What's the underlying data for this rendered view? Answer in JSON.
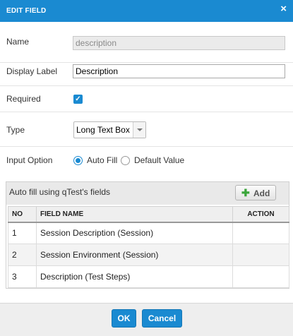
{
  "dialog": {
    "title": "EDIT FIELD",
    "close_glyph": "×"
  },
  "form": {
    "name": {
      "label": "Name",
      "value": "description",
      "disabled": true
    },
    "display_label": {
      "label": "Display Label",
      "value": "Description"
    },
    "required": {
      "label": "Required",
      "checked": true
    },
    "type": {
      "label": "Type",
      "selected": "Long Text Box"
    },
    "input_option": {
      "label": "Input Option",
      "options": [
        {
          "label": "Auto Fill",
          "selected": true
        },
        {
          "label": "Default Value",
          "selected": false
        }
      ]
    }
  },
  "autofill": {
    "title": "Auto fill using qTest's fields",
    "add_label": "Add",
    "columns": [
      "NO",
      "FIELD NAME",
      "ACTION"
    ],
    "rows": [
      {
        "no": "1",
        "field_name": "Session Description (Session)",
        "action": ""
      },
      {
        "no": "2",
        "field_name": "Session Environment (Session)",
        "action": ""
      },
      {
        "no": "3",
        "field_name": "Description (Test Steps)",
        "action": ""
      }
    ]
  },
  "footer": {
    "ok_label": "OK",
    "cancel_label": "Cancel"
  },
  "colors": {
    "accent": "#1a8ad1",
    "add_icon": "#3aa53a"
  },
  "icons": [
    "close-icon",
    "checkbox-checked-icon",
    "dropdown-arrow-icon",
    "add-plus-icon"
  ]
}
